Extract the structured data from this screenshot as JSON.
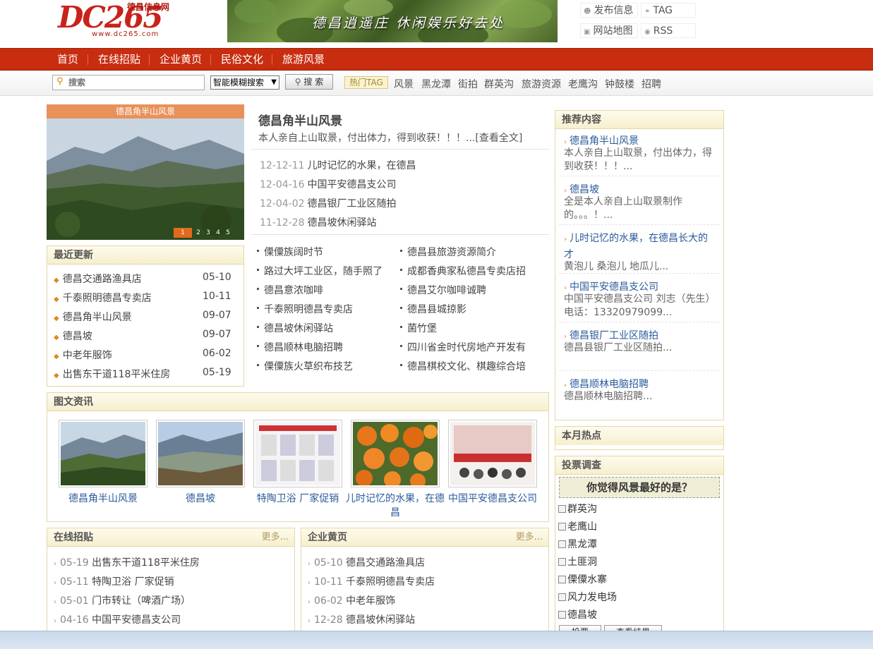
{
  "header": {
    "logo_text": "DC265",
    "site_name": "德昌信息网",
    "site_url": "www.dc265.com",
    "banner_slogan": "德昌逍遥庄  休闲娱乐好去处",
    "top_links": [
      {
        "label": "发布信息",
        "icon": "user-icon"
      },
      {
        "label": "TAG",
        "icon": "tag-icon"
      },
      {
        "label": "网站地图",
        "icon": "map-icon"
      },
      {
        "label": "RSS",
        "icon": "rss-icon"
      }
    ]
  },
  "nav": [
    "首页",
    "在线招贴",
    "企业黄页",
    "民俗文化",
    "旅游风景"
  ],
  "search": {
    "placeholder": "搜索",
    "mode": "智能模糊搜索",
    "button": "搜 索",
    "hot_label": "热门TAG",
    "hot_tags": [
      "风景",
      "黑龙潭",
      "街拍",
      "群英沟",
      "旅游资源",
      "老鹰沟",
      "钟鼓楼",
      "招聘"
    ]
  },
  "focus": {
    "caption": "德昌角半山风景",
    "pages": [
      "1",
      "2",
      "3",
      "4",
      "5"
    ],
    "active_page": 1
  },
  "latest": {
    "title": "最近更新",
    "items": [
      {
        "title": "德昌交通路渔具店",
        "date": "05-10"
      },
      {
        "title": "千泰照明德昌专卖店",
        "date": "10-11"
      },
      {
        "title": "德昌角半山风景",
        "date": "09-07"
      },
      {
        "title": "德昌坡",
        "date": "09-07"
      },
      {
        "title": "中老年服饰",
        "date": "06-02"
      },
      {
        "title": "出售东干道118平米住房",
        "date": "05-19"
      }
    ]
  },
  "headline": {
    "title": "德昌角半山风景",
    "summary": "本人亲自上山取景，付出体力，得到收获！！！...",
    "more": "[查看全文]"
  },
  "news": [
    {
      "date": "12-12-11",
      "title": "儿时记忆的水果，在德昌"
    },
    {
      "date": "12-04-16",
      "title": "中国平安德昌支公司"
    },
    {
      "date": "12-04-02",
      "title": "德昌银厂工业区随拍"
    },
    {
      "date": "11-12-28",
      "title": "德昌坡休闲驿站"
    }
  ],
  "dual_list": {
    "left": [
      "傈僳族阔时节",
      "路过大坪工业区，随手照了",
      "德昌意浓咖啡",
      "千泰照明德昌专卖店",
      "德昌坡休闲驿站",
      "德昌顺林电脑招聘",
      "傈僳族火草织布技艺"
    ],
    "right": [
      "德昌县旅游资源简介",
      "成都香典家私德昌专卖店招",
      "德昌艾尔咖啡诚聘",
      "德昌县城掠影",
      "菌竹堡",
      "四川省金时代房地产开发有",
      "德昌棋校文化、棋趣综合培"
    ]
  },
  "photo_news": {
    "title": "图文资讯",
    "items": [
      {
        "caption": "德昌角半山风景"
      },
      {
        "caption": "德昌坡"
      },
      {
        "caption": "特陶卫浴 厂家促销"
      },
      {
        "caption": "儿时记忆的水果，在德昌"
      },
      {
        "caption": "中国平安德昌支公司"
      }
    ]
  },
  "posts": {
    "title": "在线招贴",
    "more": "更多...",
    "items": [
      {
        "date": "05-19",
        "title": "出售东干道118平米住房"
      },
      {
        "date": "05-11",
        "title": "特陶卫浴 厂家促销"
      },
      {
        "date": "05-01",
        "title": "门市转让（啤酒广场）"
      },
      {
        "date": "04-16",
        "title": "中国平安德昌支公司"
      }
    ]
  },
  "yellow_pages": {
    "title": "企业黄页",
    "more": "更多...",
    "items": [
      {
        "date": "05-10",
        "title": "德昌交通路渔具店"
      },
      {
        "date": "10-11",
        "title": "千泰照明德昌专卖店"
      },
      {
        "date": "06-02",
        "title": "中老年服饰"
      },
      {
        "date": "12-28",
        "title": "德昌坡休闲驿站"
      }
    ]
  },
  "recommend": {
    "title": "推荐内容",
    "items": [
      {
        "title": "德昌角半山风景",
        "summary": "本人亲自上山取景，付出体力，得到收获！！！..."
      },
      {
        "title": "德昌坡",
        "summary": "全是本人亲自上山取景制作的。。。！..."
      },
      {
        "title": "儿时记忆的水果，在德昌长大的",
        "title2": "才",
        "summary": "黄泡儿 桑泡儿 地瓜儿..."
      },
      {
        "title": "中国平安德昌支公司",
        "summary": "中国平安德昌支公司 刘志（先生） 电话：13320979099..."
      },
      {
        "title": "德昌银厂工业区随拍",
        "summary": "德昌县银厂工业区随拍..."
      },
      {
        "title": "德昌顺林电脑招聘",
        "summary": "德昌顺林电脑招聘..."
      }
    ]
  },
  "hot_month": {
    "title": "本月热点"
  },
  "vote": {
    "title": "投票调查",
    "question": "你觉得风景最好的是？",
    "options": [
      "群英沟",
      "老鹰山",
      "黑龙潭",
      "土匪洞",
      "傈僳水寨",
      "风力发电场",
      "德昌坡"
    ],
    "vote_button": "投票",
    "result_button": "查看结果"
  },
  "colors": {
    "nav_bg": "#c82d10",
    "box_border": "#e3d8a8",
    "link": "#2a5a9a",
    "accent": "#e08a1a"
  }
}
